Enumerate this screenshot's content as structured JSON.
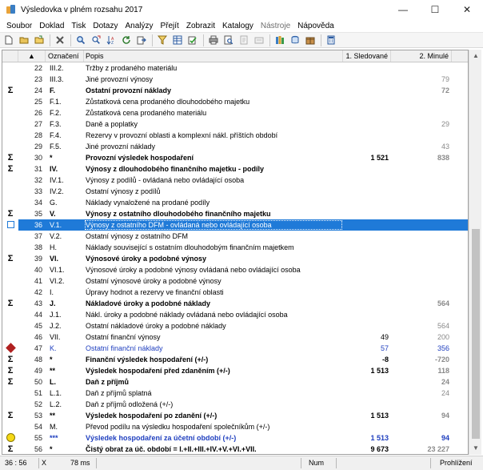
{
  "window": {
    "title": "Výsledovka v plném rozsahu 2017",
    "minimize_glyph": "—",
    "maximize_glyph": "☐",
    "close_glyph": "✕"
  },
  "menu": [
    "Soubor",
    "Doklad",
    "Tisk",
    "Dotazy",
    "Analýzy",
    "Přejít",
    "Zobrazit",
    "Katalogy",
    "Nástroje",
    "Nápověda"
  ],
  "toolbar": {
    "icons": [
      "new-document-icon",
      "save-icon",
      "open-folder-icon",
      "delete-icon",
      "search-icon",
      "find-next-icon",
      "sort-icon",
      "refresh-icon",
      "export-icon",
      "filter-icon",
      "columns-icon",
      "check-icon",
      "print-icon",
      "print-preview-icon",
      "page-setup-icon",
      "tools-icon",
      "books-icon",
      "database-icon",
      "package-icon",
      "calculator-icon"
    ]
  },
  "grid": {
    "headers": {
      "sort_indicator": "▲",
      "code": "Označení",
      "desc": "Popis",
      "v1": "1. Sledované",
      "v2": "2. Minulé"
    },
    "rows": [
      {
        "mark": "",
        "num": "22",
        "code": "III.2.",
        "desc": "Tržby z prodaného materiálu",
        "v1": "",
        "v2": "",
        "style": ""
      },
      {
        "mark": "",
        "num": "23",
        "code": "III.3.",
        "desc": "Jiné provozní výnosy",
        "v1": "",
        "v2": "79",
        "style": ""
      },
      {
        "mark": "Σ",
        "num": "24",
        "code": "F.",
        "desc": "Ostatní provozní náklady",
        "v1": "",
        "v2": "72",
        "style": "bold"
      },
      {
        "mark": "",
        "num": "25",
        "code": "F.1.",
        "desc": "Zůstatková cena prodaného dlouhodobého majetku",
        "v1": "",
        "v2": "",
        "style": ""
      },
      {
        "mark": "",
        "num": "26",
        "code": "F.2.",
        "desc": "Zůstatková cena prodaného materiálu",
        "v1": "",
        "v2": "",
        "style": ""
      },
      {
        "mark": "",
        "num": "27",
        "code": "F.3.",
        "desc": "Daně a poplatky",
        "v1": "",
        "v2": "29",
        "style": ""
      },
      {
        "mark": "",
        "num": "28",
        "code": "F.4.",
        "desc": "Rezervy v provozní oblasti a komplexní nákl. příštích období",
        "v1": "",
        "v2": "",
        "style": ""
      },
      {
        "mark": "",
        "num": "29",
        "code": "F.5.",
        "desc": "Jiné provozní náklady",
        "v1": "",
        "v2": "43",
        "style": ""
      },
      {
        "mark": "Σ",
        "num": "30",
        "code": "*",
        "desc": "Provozní výsledek hospodaření",
        "v1": "1 521",
        "v2": "838",
        "style": "bold"
      },
      {
        "mark": "Σ",
        "num": "31",
        "code": "IV.",
        "desc": "Výnosy z dlouhodobého finančního majetku - podíly",
        "v1": "",
        "v2": "",
        "style": "bold"
      },
      {
        "mark": "",
        "num": "32",
        "code": "IV.1.",
        "desc": "Výnosy z podílů - ovládaná nebo ovládající osoba",
        "v1": "",
        "v2": "",
        "style": ""
      },
      {
        "mark": "",
        "num": "33",
        "code": "IV.2.",
        "desc": "Ostatní výnosy z podílů",
        "v1": "",
        "v2": "",
        "style": ""
      },
      {
        "mark": "",
        "num": "34",
        "code": "G.",
        "desc": "Náklady vynaložené na prodané podíly",
        "v1": "",
        "v2": "",
        "style": ""
      },
      {
        "mark": "Σ",
        "num": "35",
        "code": "V.",
        "desc": "Výnosy z ostatního dlouhodobého finančního majetku",
        "v1": "",
        "v2": "",
        "style": "bold"
      },
      {
        "mark": "box",
        "num": "36",
        "code": "V.1.",
        "desc": "Výnosy z ostatního DFM - ovládaná nebo ovládající osoba",
        "v1": "",
        "v2": "",
        "style": "selected"
      },
      {
        "mark": "",
        "num": "37",
        "code": "V.2.",
        "desc": "Ostatní výnosy z ostatního DFM",
        "v1": "",
        "v2": "",
        "style": ""
      },
      {
        "mark": "",
        "num": "38",
        "code": "H.",
        "desc": "Náklady související s ostatním dlouhodobým finančním majetkem",
        "v1": "",
        "v2": "",
        "style": ""
      },
      {
        "mark": "Σ",
        "num": "39",
        "code": "VI.",
        "desc": "Výnosové úroky a podobné výnosy",
        "v1": "",
        "v2": "",
        "style": "bold"
      },
      {
        "mark": "",
        "num": "40",
        "code": "VI.1.",
        "desc": "Výnosové úroky a podobné výnosy ovládaná nebo ovládající osoba",
        "v1": "",
        "v2": "",
        "style": ""
      },
      {
        "mark": "",
        "num": "41",
        "code": "VI.2.",
        "desc": "Ostatní výnosové úroky a podobné výnosy",
        "v1": "",
        "v2": "",
        "style": ""
      },
      {
        "mark": "",
        "num": "42",
        "code": "I.",
        "desc": "Úpravy hodnot a rezervy ve finanční oblasti",
        "v1": "",
        "v2": "",
        "style": ""
      },
      {
        "mark": "Σ",
        "num": "43",
        "code": "J.",
        "desc": "Nákladové úroky a podobné náklady",
        "v1": "",
        "v2": "564",
        "style": "bold"
      },
      {
        "mark": "",
        "num": "44",
        "code": "J.1.",
        "desc": "Nákl. úroky a podobné náklady ovládaná nebo ovládající osoba",
        "v1": "",
        "v2": "",
        "style": ""
      },
      {
        "mark": "",
        "num": "45",
        "code": "J.2.",
        "desc": "Ostatní nákladové úroky a podobné náklady",
        "v1": "",
        "v2": "564",
        "style": ""
      },
      {
        "mark": "",
        "num": "46",
        "code": "VII.",
        "desc": "Ostatní finanční výnosy",
        "v1": "49",
        "v2": "200",
        "style": ""
      },
      {
        "mark": "diamond",
        "num": "47",
        "code": "K.",
        "desc": "Ostatní finanční náklady",
        "v1": "57",
        "v2": "356",
        "style": "blue"
      },
      {
        "mark": "Σ",
        "num": "48",
        "code": "*",
        "desc": "Finanční výsledek hospodaření (+/-)",
        "v1": "-8",
        "v2": "-720",
        "style": "bold"
      },
      {
        "mark": "Σ",
        "num": "49",
        "code": "**",
        "desc": "Výsledek hospodaření před zdaněním (+/-)",
        "v1": "1 513",
        "v2": "118",
        "style": "bold"
      },
      {
        "mark": "Σ",
        "num": "50",
        "code": "L.",
        "desc": "Daň z příjmů",
        "v1": "",
        "v2": "24",
        "style": "bold"
      },
      {
        "mark": "",
        "num": "51",
        "code": "L.1.",
        "desc": "Daň z příjmů splatná",
        "v1": "",
        "v2": "24",
        "style": ""
      },
      {
        "mark": "",
        "num": "52",
        "code": "L.2.",
        "desc": "Daň z příjmů odložená (+/-)",
        "v1": "",
        "v2": "",
        "style": ""
      },
      {
        "mark": "Σ",
        "num": "53",
        "code": "**",
        "desc": "Výsledek hospodaření po zdanění (+/-)",
        "v1": "1 513",
        "v2": "94",
        "style": "bold"
      },
      {
        "mark": "",
        "num": "54",
        "code": "M.",
        "desc": "Převod podílu na výsledku hospodaření společníkům (+/-)",
        "v1": "",
        "v2": "",
        "style": ""
      },
      {
        "mark": "circle",
        "num": "55",
        "code": "***",
        "desc": "Výsledek hospodaření za účetní období (+/-)",
        "v1": "1 513",
        "v2": "94",
        "style": "bold blue"
      },
      {
        "mark": "Σ",
        "num": "56",
        "code": "*",
        "desc": "Čistý obrat za úč. období = I.+II.+III.+IV.+V.+VI.+VII.",
        "v1": "9 673",
        "v2": "23 227",
        "style": "bold"
      }
    ]
  },
  "statusbar": {
    "position": "36 :  56",
    "mode": "X",
    "time": "78 ms",
    "num": "Num",
    "state": "Prohlížení"
  }
}
